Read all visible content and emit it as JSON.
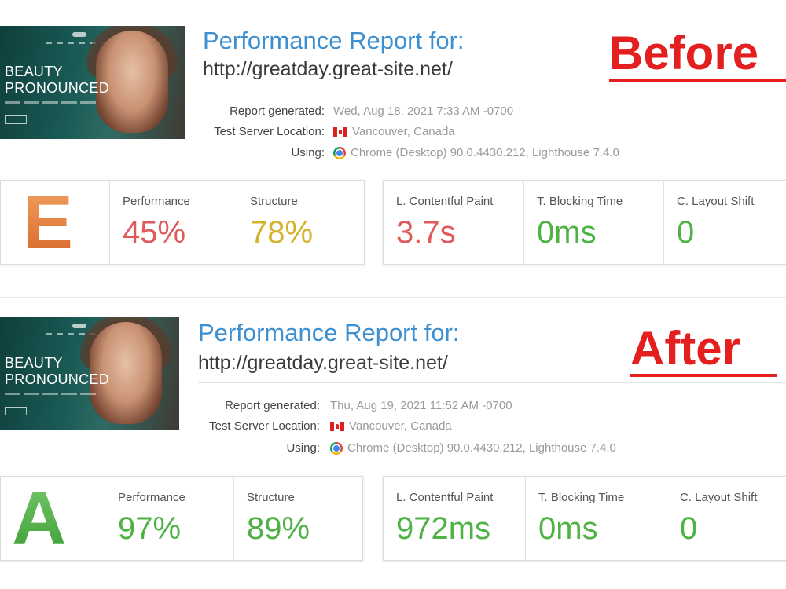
{
  "reports": [
    {
      "stamp": "Before",
      "thumbnail": {
        "line1": "BEAUTY",
        "line2": "PRONOUNCED"
      },
      "title": "Performance Report for:",
      "url": "http://greatday.great-site.net/",
      "meta": {
        "report_generated_label": "Report generated:",
        "report_generated_value": "Wed, Aug 18, 2021 7:33 AM -0700",
        "location_label": "Test Server Location:",
        "location_value": "Vancouver, Canada",
        "using_label": "Using:",
        "using_value": "Chrome (Desktop) 90.0.4430.212, Lighthouse 7.4.0"
      },
      "grade": "E",
      "scores": {
        "performance_label": "Performance",
        "performance_value": "45%",
        "structure_label": "Structure",
        "structure_value": "78%",
        "lcp_label": "L. Contentful Paint",
        "lcp_value": "3.7s",
        "tbt_label": "T. Blocking Time",
        "tbt_value": "0ms",
        "cls_label": "C. Layout Shift",
        "cls_value": "0"
      }
    },
    {
      "stamp": "After",
      "thumbnail": {
        "line1": "BEAUTY",
        "line2": "PRONOUNCED"
      },
      "title": "Performance Report for:",
      "url": "http://greatday.great-site.net/",
      "meta": {
        "report_generated_label": "Report generated:",
        "report_generated_value": "Thu, Aug 19, 2021 11:52 AM -0700",
        "location_label": "Test Server Location:",
        "location_value": "Vancouver, Canada",
        "using_label": "Using:",
        "using_value": "Chrome (Desktop) 90.0.4430.212, Lighthouse 7.4.0"
      },
      "grade": "A",
      "scores": {
        "performance_label": "Performance",
        "performance_value": "97%",
        "structure_label": "Structure",
        "structure_value": "89%",
        "lcp_label": "L. Contentful Paint",
        "lcp_value": "972ms",
        "tbt_label": "T. Blocking Time",
        "tbt_value": "0ms",
        "cls_label": "C. Layout Shift",
        "cls_value": "0"
      }
    }
  ],
  "colors": {
    "title_blue": "#3d8fcf",
    "stamp_red": "#e41f1f",
    "bad_red": "#e05a5a",
    "warn_yellow": "#d4b22a",
    "good_green": "#4fb244",
    "grade_e_orange": "#e07b3a"
  },
  "icons": {
    "flag": "canada-flag-icon",
    "browser": "chrome-icon"
  }
}
